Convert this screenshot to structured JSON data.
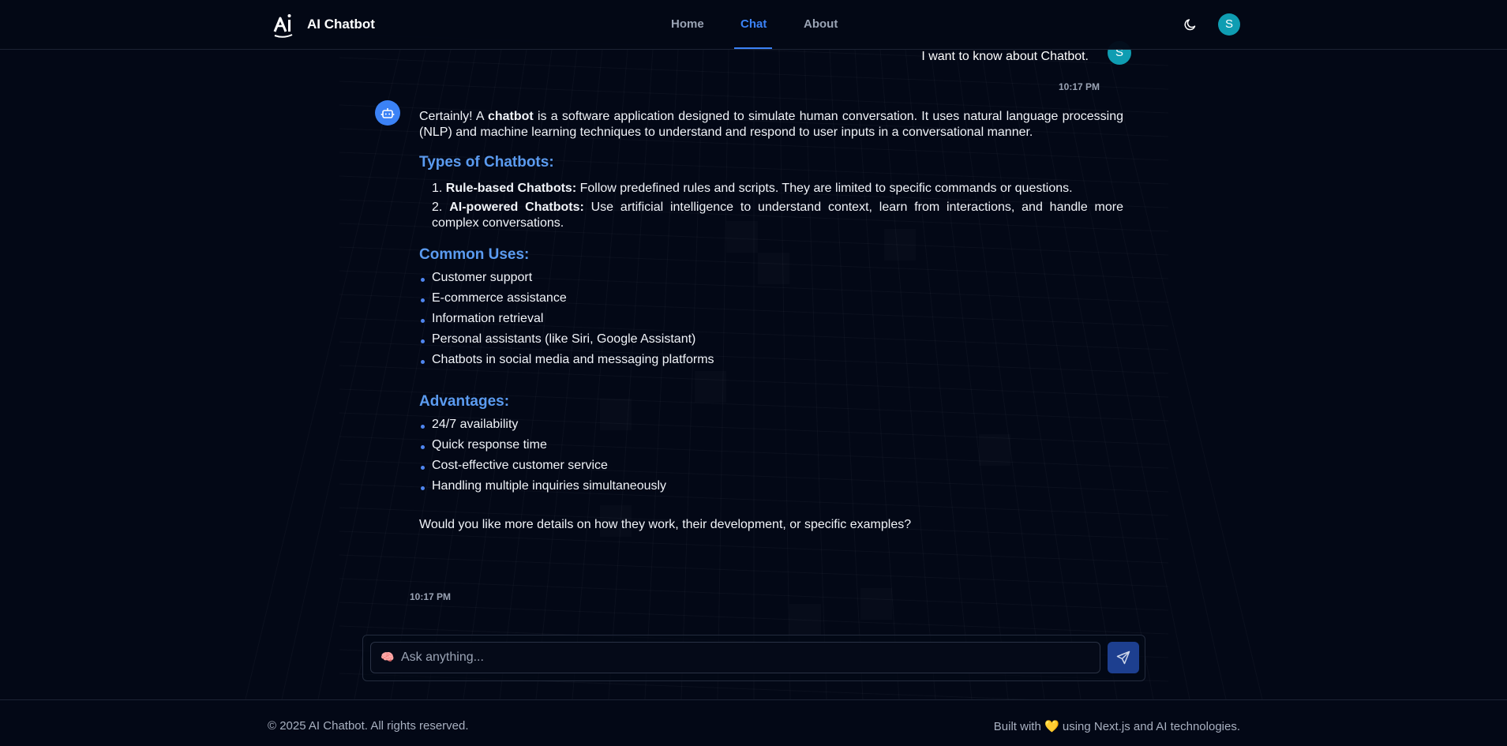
{
  "header": {
    "brand": "AI Chatbot",
    "nav": [
      {
        "label": "Home"
      },
      {
        "label": "Chat",
        "active": true
      },
      {
        "label": "About"
      }
    ],
    "theme_icon": "moon-icon",
    "avatar_initial": "S"
  },
  "chat": {
    "user_message": {
      "text": "I want to know about Chatbot.",
      "avatar_initial": "S",
      "time": "10:17 PM"
    },
    "bot_message": {
      "intro_prefix": "Certainly! A ",
      "intro_bold": "chatbot",
      "intro_rest": " is a software application designed to simulate human conversation. It uses natural language processing (NLP) and machine learning techniques to understand and respond to user inputs in a conversational manner.",
      "types_heading": "Types of Chatbots:",
      "types": [
        {
          "num": "1.",
          "title": "Rule-based Chatbots:",
          "text": " Follow predefined rules and scripts. They are limited to specific commands or questions."
        },
        {
          "num": "2.",
          "title": "AI-powered Chatbots:",
          "text": " Use artificial intelligence to understand context, learn from interactions, and handle more complex conversations."
        }
      ],
      "uses_heading": "Common Uses:",
      "uses": [
        "Customer support",
        "E-commerce assistance",
        "Information retrieval",
        "Personal assistants (like Siri, Google Assistant)",
        "Chatbots in social media and messaging platforms"
      ],
      "advantages_heading": "Advantages:",
      "advantages": [
        "24/7 availability",
        "Quick response time",
        "Cost-effective customer service",
        "Handling multiple inquiries simultaneously"
      ],
      "closing": "Would you like more details on how they work, their development, or specific examples?",
      "time": "10:17 PM"
    }
  },
  "input": {
    "emoji": "🧠",
    "placeholder": "Ask anything...",
    "value": ""
  },
  "footer": {
    "copyright": "© 2025 AI Chatbot. All rights reserved.",
    "built_prefix": "Built with",
    "heart": "💛",
    "built_suffix": "using Next.js and AI technologies."
  },
  "colors": {
    "background": "#030816",
    "accent": "#3b82f6",
    "heading": "#5b9bf0",
    "avatar": "#0f9db2",
    "send_button": "#1d3f8f"
  }
}
